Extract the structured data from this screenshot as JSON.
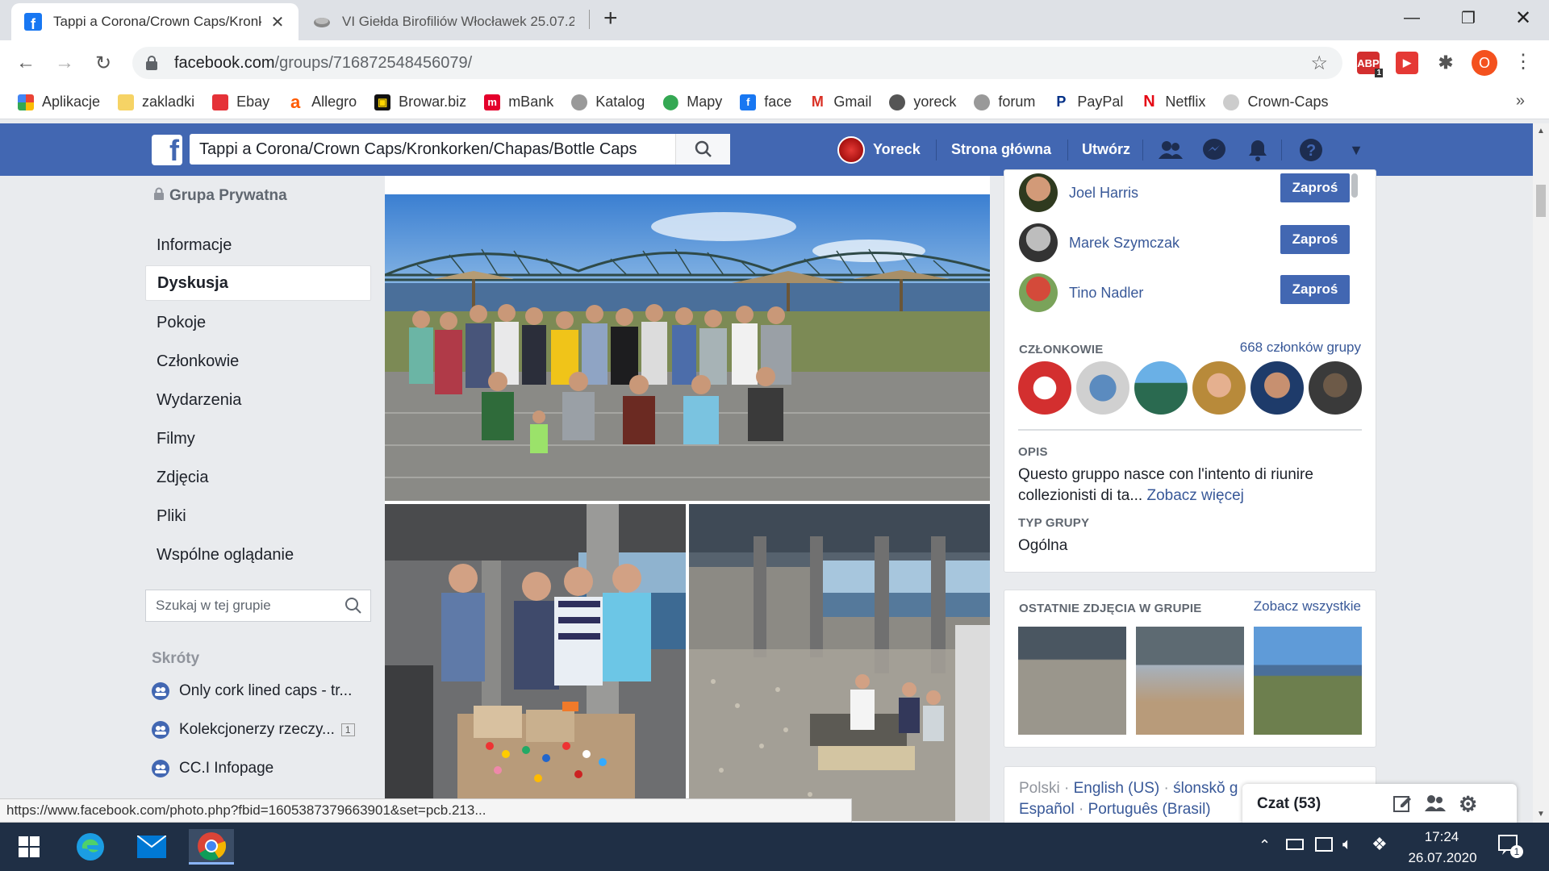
{
  "browser": {
    "tabs": [
      {
        "title": "Tappi a Corona/Crown Caps/Kronkorken/Chapas/Bottle Caps",
        "active": true
      },
      {
        "title": "VI Giełda Birofiliów Włocławek 25.07.2020",
        "active": false
      }
    ],
    "new_tab": "+",
    "url_host": "facebook.com",
    "url_path": "/groups/716872548456079/",
    "profile_initial": "O",
    "ext_badge": "1",
    "bookmarks": [
      "Aplikacje",
      "zakladki",
      "Ebay",
      "Allegro",
      "Browar.biz",
      "mBank",
      "Katalog",
      "Mapy",
      "face",
      "Gmail",
      "yoreck",
      "forum",
      "PayPal",
      "Netflix",
      "Crown-Caps"
    ],
    "bookmarks_more": "»"
  },
  "fb": {
    "search_value": "Tappi a Corona/Crown Caps/Kronkorken/Chapas/Bottle Caps",
    "user": "Yoreck",
    "home": "Strona główna",
    "create": "Utwórz",
    "accent": "#4267b2"
  },
  "left": {
    "privacy": "Grupa Prywatna",
    "nav": [
      "Informacje",
      "Dyskusja",
      "Pokoje",
      "Członkowie",
      "Wydarzenia",
      "Filmy",
      "Zdjęcia",
      "Pliki",
      "Wspólne oglądanie"
    ],
    "selected_index": 1,
    "search_placeholder": "Szukaj w tej grupie",
    "shortcuts_title": "Skróty",
    "shortcuts": [
      {
        "label": "Only cork lined caps - tr...",
        "badge": ""
      },
      {
        "label": "Kolekcjonerzy rzeczy...",
        "badge": "1"
      },
      {
        "label": "CC.I Infopage",
        "badge": ""
      }
    ]
  },
  "right": {
    "suggested": [
      {
        "name": "Joel Harris",
        "button": "Zaproś"
      },
      {
        "name": "Marek Szymczak",
        "button": "Zaproś"
      },
      {
        "name": "Tino Nadler",
        "button": "Zaproś"
      }
    ],
    "members_title": "CZŁONKOWIE",
    "members_count": "668 członków grupy",
    "desc_title": "OPIS",
    "desc_text": "Questo gruppo nasce con l'intento di riunire collezionisti di ta...",
    "desc_more": "Zobacz więcej",
    "type_title": "TYP GRUPY",
    "type_value": "Ogólna",
    "photos_title": "OSTATNIE ZDJĘCIA W GRUPIE",
    "photos_all": "Zobacz wszystkie",
    "languages": [
      "Polski",
      "English (US)",
      "ślonskŏ g",
      "Español",
      "Português (Brasil)"
    ],
    "lang_sep": "·"
  },
  "chat": {
    "label": "Czat (53)"
  },
  "status_url": "https://www.facebook.com/photo.php?fbid=1605387379663901&set=pcb.213...",
  "taskbar": {
    "time": "17:24",
    "date": "26.07.2020",
    "notif": "1"
  }
}
